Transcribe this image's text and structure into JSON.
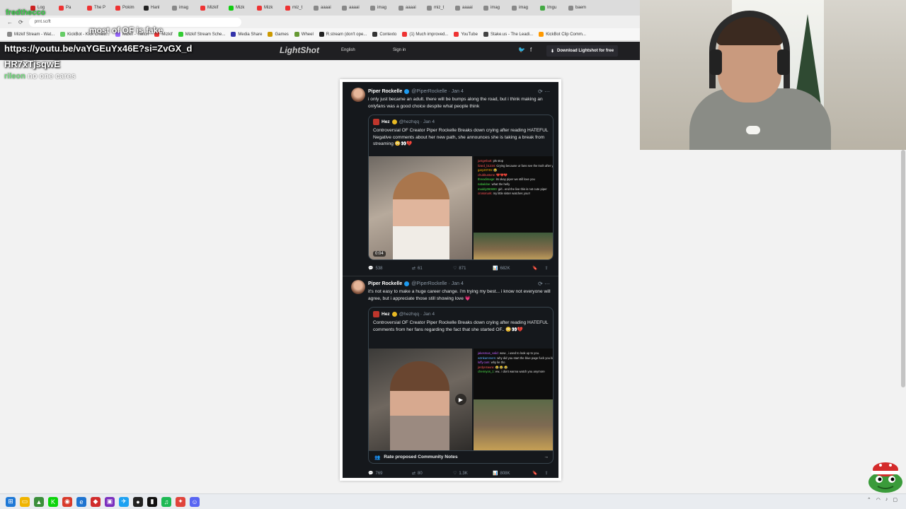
{
  "browser": {
    "tabs": [
      "Log",
      "Pa",
      "The P",
      "Pokim",
      "Hanl",
      "imag",
      "Mizkif",
      "Mizk",
      "Mizk",
      "miz_t",
      "aaaai",
      "aaaai",
      "imag",
      "aaaai",
      "miz_t",
      "aaaai",
      "imag",
      "imag",
      "Imgu",
      "baem"
    ],
    "address": "prnt.sc/ft",
    "bookmarks": [
      "Mizkif Stream - Wat...",
      "KickBot - Kick Chatb...",
      "Mizkif - Twitch",
      "Mizkif",
      "Mizkif Stream Sche...",
      "Media Share",
      "Games",
      "Wheel",
      "R.stream (don't ope...",
      "Contexto",
      "(1) Much improved...",
      "YouTube",
      "Stake.us - The Leadi...",
      "KickBot Clip Comm..."
    ]
  },
  "lightshot": {
    "logo": "LightShot",
    "language": "English",
    "sign_in": "Sign in",
    "download": "Download Lightshot for free"
  },
  "chat_overlay": {
    "user": "fredthecco",
    "message_1": "most of OF is fake",
    "link": "https://youtu.be/vaYGEuYx46E?si=ZvGX_dHR7xTjsqwE",
    "last_user": "rileon",
    "last_message": "no one cares"
  },
  "tweets": [
    {
      "name": "Piper Rockelle",
      "handle": "@PiperRockelle · Jan 4",
      "text": "i only just became an adult. there will be bumps along the road, but i think making an onlyfans was a good choice despite what people think",
      "quote": {
        "name": "Hez",
        "handle": "@hezhqq · Jan 4",
        "text": "Controversial OF Creator Piper Rockelle Breaks down crying after reading HATEFUL Negative comments about her new path, she announces she is taking a break from streaming 😳👀💔",
        "timestamp": "0:04",
        "chat": [
          {
            "user": "justgetbutt",
            "msg": "pls stop",
            "c": "n1"
          },
          {
            "user": "lizard_b1234",
            "msg": "Crying because ur fans see the truth after you dropped a OF? sounds like ur problem",
            "c": "n1"
          },
          {
            "user": "gary20745",
            "msg": "😂",
            "c": "n4"
          },
          {
            "user": "chubbustone",
            "msg": "💔💔💔",
            "c": "n1"
          },
          {
            "user": "threadimage",
            "msg": "its okay piper we still love you",
            "c": "n2"
          },
          {
            "user": "nabaldoe",
            "msg": "what the helly",
            "c": "n2"
          },
          {
            "user": "maddy060800",
            "msg": "girl.. end the live this is not cute piper",
            "c": "n2"
          },
          {
            "user": "crossmark",
            "msg": "my little sister watches you!!",
            "c": "n1"
          }
        ]
      },
      "stats": {
        "replies": "538",
        "reposts": "61",
        "likes": "871",
        "views": "682K"
      }
    },
    {
      "name": "Piper Rockelle",
      "handle": "@PiperRockelle · Jan 4",
      "text": "it's not easy to make a huge career change. i'm trying my best... i know not everyone will agree, but i appreciate those still showing love 💗",
      "quote": {
        "name": "Hez",
        "handle": "@hezhqq · Jan 4",
        "text": "Controversial OF Creator Piper Rockelle Breaks down crying after reading HATEFUL comments from her fans regarding the fact that she started OF.. 😳👀💔",
        "chat": [
          {
            "user": "jakesmas_valid",
            "msg": "wow , i used to look up to you.",
            "c": "n3"
          },
          {
            "user": "w3nkammers",
            "msg": "why did you start the blue page fuck you bitch",
            "c": "n5"
          },
          {
            "user": "luffy.cam",
            "msg": "why lie tho",
            "c": "n3"
          },
          {
            "user": "jordyn4aura",
            "msg": "😂 😂 😂",
            "c": "n1"
          },
          {
            "user": "chennyos_1",
            "msg": "ew.. i dont wanna watch you anymore",
            "c": "n2"
          }
        ],
        "community_notes": "Rate proposed Community Notes"
      },
      "stats": {
        "replies": "769",
        "reposts": "80",
        "likes": "1.3K",
        "views": "808K"
      }
    }
  ]
}
